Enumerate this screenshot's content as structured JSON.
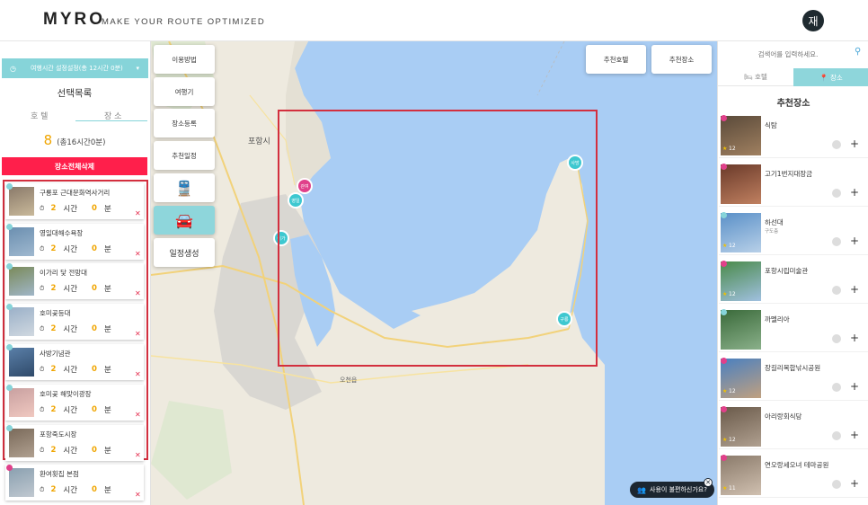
{
  "header": {
    "logo": "MYRO",
    "tagline": "MAKE YOUR ROUTE OPTIMIZED",
    "avatar": "재"
  },
  "left": {
    "time_setting": "여행시간 설정설정(총 12시간 0분)",
    "title": "선택목록",
    "tabs": [
      "호 텔",
      "장 소"
    ],
    "count": "8",
    "total": "(총16시간0분)",
    "delete_all": "장소전체삭제",
    "items": [
      {
        "name": "구룡포 근대문화역사거리",
        "hours": "2",
        "mins": "0"
      },
      {
        "name": "영일대해수욕장",
        "hours": "2",
        "mins": "0"
      },
      {
        "name": "이가리 닻 전망대",
        "hours": "2",
        "mins": "0"
      },
      {
        "name": "호미곶등대",
        "hours": "2",
        "mins": "0"
      },
      {
        "name": "사방기념관",
        "hours": "2",
        "mins": "0"
      },
      {
        "name": "호미곶 해맞이광장",
        "hours": "2",
        "mins": "0"
      },
      {
        "name": "포항죽도시장",
        "hours": "2",
        "mins": "0"
      },
      {
        "name": "환여횟집 본점",
        "hours": "2",
        "mins": "0"
      }
    ],
    "hour_unit": "시간",
    "min_unit": "분"
  },
  "map": {
    "buttons": [
      "이용방법",
      "여행기",
      "장소등록",
      "추천일정",
      "일정생성"
    ],
    "top_buttons": [
      "추천호텔",
      "추천장소"
    ],
    "labels": {
      "pohang": "포항시",
      "ocheon": "오천읍"
    },
    "pins": [
      "관여",
      "영일",
      "이가",
      "구룡",
      "사방"
    ],
    "chat": "사용이 불편하신가요?"
  },
  "right": {
    "search_placeholder": "검색어를 입력하세요.",
    "tab_hotel": "호텔",
    "tab_place": "장소",
    "title": "추천장소",
    "items": [
      {
        "name": "식탐",
        "sub": "",
        "rating": "12"
      },
      {
        "name": "고기1번지대장금",
        "sub": "",
        "rating": ""
      },
      {
        "name": "하선대",
        "sub": "구도층",
        "rating": "12"
      },
      {
        "name": "포항시립미술관",
        "sub": "",
        "rating": "12"
      },
      {
        "name": "까멜리아",
        "sub": "",
        "rating": ""
      },
      {
        "name": "장길리복합낚시공원",
        "sub": "",
        "rating": "12"
      },
      {
        "name": "아리랑회식당",
        "sub": "",
        "rating": "12"
      },
      {
        "name": "연오랑세오녀 테마공원",
        "sub": "",
        "rating": "11"
      }
    ]
  },
  "colors": {
    "accent": "#86d4d9",
    "delete": "#ff1f4b",
    "highlight": "#d32f3e",
    "count": "#f0a500"
  }
}
